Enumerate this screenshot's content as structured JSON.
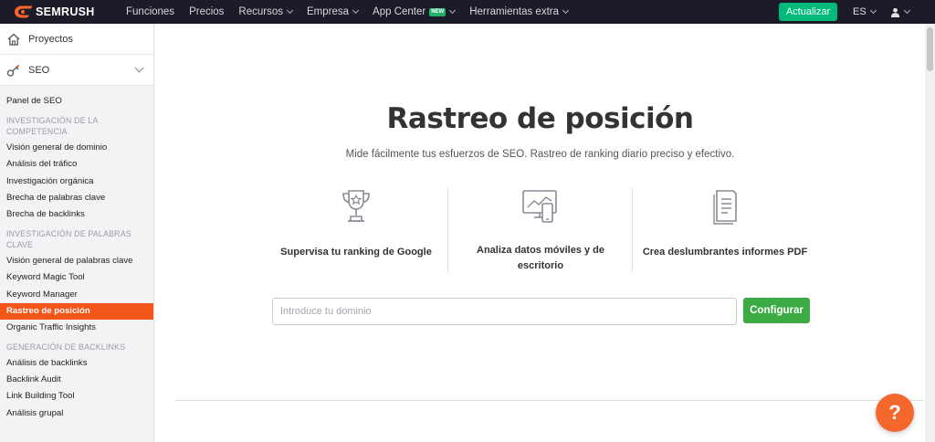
{
  "topbar": {
    "logo_text": "SEMRUSH",
    "nav": [
      {
        "label": "Funciones",
        "dropdown": false
      },
      {
        "label": "Precios",
        "dropdown": false
      },
      {
        "label": "Recursos",
        "dropdown": true
      },
      {
        "label": "Empresa",
        "dropdown": true
      },
      {
        "label": "App Center",
        "dropdown": true,
        "badge": "NEW"
      },
      {
        "label": "Herramientas extra",
        "dropdown": true
      }
    ],
    "upgrade_label": "Actualizar",
    "language": "ES",
    "colors": {
      "bar": "#1c1c28",
      "upgrade": "#00ba7c"
    }
  },
  "sidebar": {
    "projects_label": "Proyectos",
    "seo_label": "SEO",
    "groups": [
      {
        "section": "",
        "items": [
          "Panel de SEO"
        ]
      },
      {
        "section": "INVESTIGACIÓN DE LA COMPETENCIA",
        "items": [
          "Visión general de dominio",
          "Análisis del tráfico",
          "Investigación orgánica",
          "Brecha de palabras clave",
          "Brecha de backlinks"
        ]
      },
      {
        "section": "INVESTIGACIÓN DE PALABRAS CLAVE",
        "items": [
          "Visión general de palabras clave",
          "Keyword Magic Tool",
          "Keyword Manager",
          "Rastreo de posición",
          "Organic Traffic Insights"
        ]
      },
      {
        "section": "GENERACIÓN DE BACKLINKS",
        "items": [
          "Análisis de backlinks",
          "Backlink Audit",
          "Link Building Tool",
          "Análisis grupal"
        ]
      }
    ],
    "active_item": "Rastreo de posición",
    "active_color": "#f4561a"
  },
  "main": {
    "title": "Rastreo de posición",
    "subtitle": "Mide fácilmente tus esfuerzos de SEO. Rastreo de ranking diario preciso y efectivo.",
    "features": [
      {
        "icon": "trophy-icon",
        "label_lines": [
          "Supervisa tu ranking de Google"
        ]
      },
      {
        "icon": "desktop-mobile-icon",
        "label_lines": [
          "Analiza datos móviles y de",
          "escritorio"
        ]
      },
      {
        "icon": "document-icon",
        "label_lines": [
          "Crea deslumbrantes informes PDF"
        ]
      }
    ],
    "domain_placeholder": "Introduce tu dominio",
    "configure_label": "Configurar",
    "configure_color": "#3bab43"
  },
  "help": {
    "label": "?",
    "color": "#f4672c"
  }
}
